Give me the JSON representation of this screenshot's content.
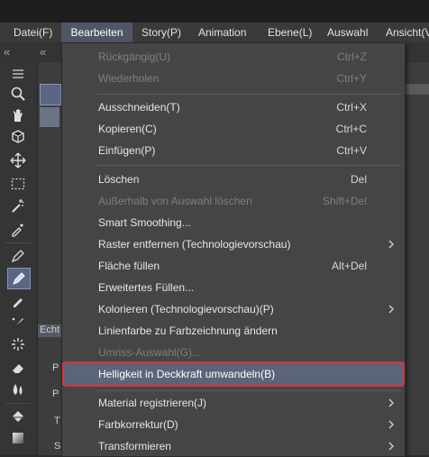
{
  "menubar": {
    "items": [
      "Datei(F)",
      "Bearbeiten",
      "Story(P)",
      "Animation",
      "Ebene(L)",
      "Auswahl",
      "Ansicht(V"
    ],
    "active_index": 1
  },
  "edit_menu": {
    "items": [
      {
        "label": "Rückgängig(U)",
        "shortcut": "Ctrl+Z",
        "enabled": false
      },
      {
        "label": "Wiederholen",
        "shortcut": "Ctrl+Y",
        "enabled": false
      },
      {
        "label": "Ausschneiden(T)",
        "shortcut": "Ctrl+X",
        "enabled": true
      },
      {
        "label": "Kopieren(C)",
        "shortcut": "Ctrl+C",
        "enabled": true
      },
      {
        "label": "Einfügen(P)",
        "shortcut": "Ctrl+V",
        "enabled": true
      },
      {
        "label": "Löschen",
        "shortcut": "Del",
        "enabled": true
      },
      {
        "label": "Außerhalb von Auswahl löschen",
        "shortcut": "Shift+Del",
        "enabled": false
      },
      {
        "label": "Smart Smoothing...",
        "shortcut": "",
        "enabled": true
      },
      {
        "label": "Raster entfernen (Technologievorschau)",
        "shortcut": "",
        "enabled": true,
        "submenu": true
      },
      {
        "label": "Fläche füllen",
        "shortcut": "Alt+Del",
        "enabled": true
      },
      {
        "label": "Erweitertes Füllen...",
        "shortcut": "",
        "enabled": true
      },
      {
        "label": "Kolorieren (Technologievorschau)(P)",
        "shortcut": "",
        "enabled": true,
        "submenu": true
      },
      {
        "label": "Linienfarbe zu Farbzeichnung ändern",
        "shortcut": "",
        "enabled": true
      },
      {
        "label": "Umriss-Auswahl(G)...",
        "shortcut": "",
        "enabled": false
      },
      {
        "label": "Helligkeit in Deckkraft umwandeln(B)",
        "shortcut": "",
        "enabled": true,
        "highlighted": true
      },
      {
        "label": "Material registrieren(J)",
        "shortcut": "",
        "enabled": true,
        "submenu": true
      },
      {
        "label": "Farbkorrektur(D)",
        "shortcut": "",
        "enabled": true,
        "submenu": true
      },
      {
        "label": "Transformieren",
        "shortcut": "",
        "enabled": true,
        "submenu": true
      }
    ]
  },
  "side_panel": {
    "labels": [
      "Echt",
      "P",
      "P",
      "T",
      "S"
    ]
  },
  "colors": {
    "highlight": "#5b6478",
    "red_outline": "#d9333a",
    "menu_bg": "#454545",
    "tool_selected": "#5a6682"
  }
}
